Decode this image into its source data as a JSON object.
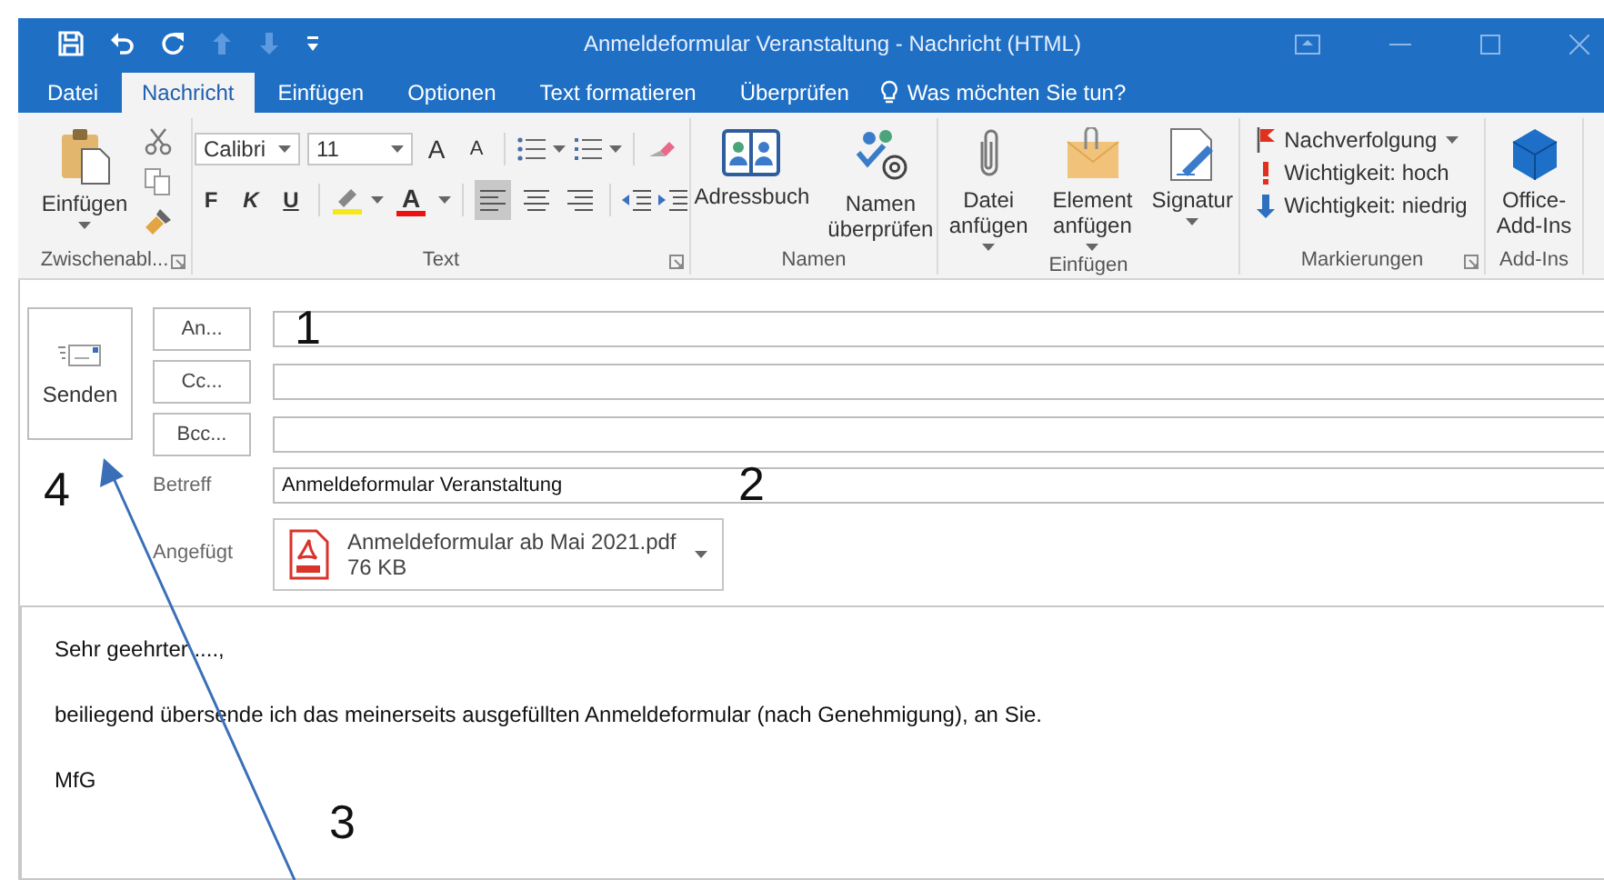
{
  "window": {
    "title": "Anmeldeformular Veranstaltung - Nachricht (HTML)"
  },
  "tabs": [
    {
      "label": "Datei",
      "selected": false
    },
    {
      "label": "Nachricht",
      "selected": true
    },
    {
      "label": "Einfügen",
      "selected": false
    },
    {
      "label": "Optionen",
      "selected": false
    },
    {
      "label": "Text formatieren",
      "selected": false
    },
    {
      "label": "Überprüfen",
      "selected": false
    }
  ],
  "tell_me": {
    "placeholder": "Was möchten Sie tun?"
  },
  "ribbon": {
    "clipboard": {
      "label": "Zwischenabl...",
      "paste": "Einfügen"
    },
    "text": {
      "label": "Text",
      "font": "Calibri",
      "size": "11",
      "grow": "A",
      "shrink": "A",
      "styles": [
        "F",
        "K",
        "U"
      ],
      "font_color": "A",
      "alignments": [
        {
          "selected": true
        },
        {
          "selected": false
        },
        {
          "selected": false
        }
      ]
    },
    "names": {
      "label": "Namen",
      "buttons": [
        "Adressbuch",
        "Namen überprüfen"
      ]
    },
    "insert": {
      "label": "Einfügen",
      "buttons": [
        "Datei anfügen",
        "Element anfügen",
        "Signatur"
      ]
    },
    "tags": {
      "label": "Markierungen",
      "items": [
        {
          "kind": "flag",
          "label": "Nachverfolgung"
        },
        {
          "kind": "high",
          "label": "Wichtigkeit: hoch"
        },
        {
          "kind": "low",
          "label": "Wichtigkeit: niedrig"
        }
      ]
    },
    "addins": {
      "label": "Add-Ins",
      "button": "Office-Add-Ins"
    }
  },
  "compose": {
    "send": "Senden",
    "recipients": [
      "An...",
      "Cc...",
      "Bcc..."
    ],
    "subject_label": "Betreff",
    "subject": "Anmeldeformular Veranstaltung",
    "attached_label": "Angefügt",
    "attachment": {
      "name": "Anmeldeformular ab Mai 2021.pdf",
      "size": "76 KB"
    },
    "body": [
      "Sehr geehrter ....,",
      "beiliegend übersende ich das meinerseits ausgefüllten Anmeldeformular (nach Genehmigung), an Sie.",
      "MfG"
    ]
  },
  "annotations": [
    "1",
    "2",
    "3",
    "4"
  ]
}
